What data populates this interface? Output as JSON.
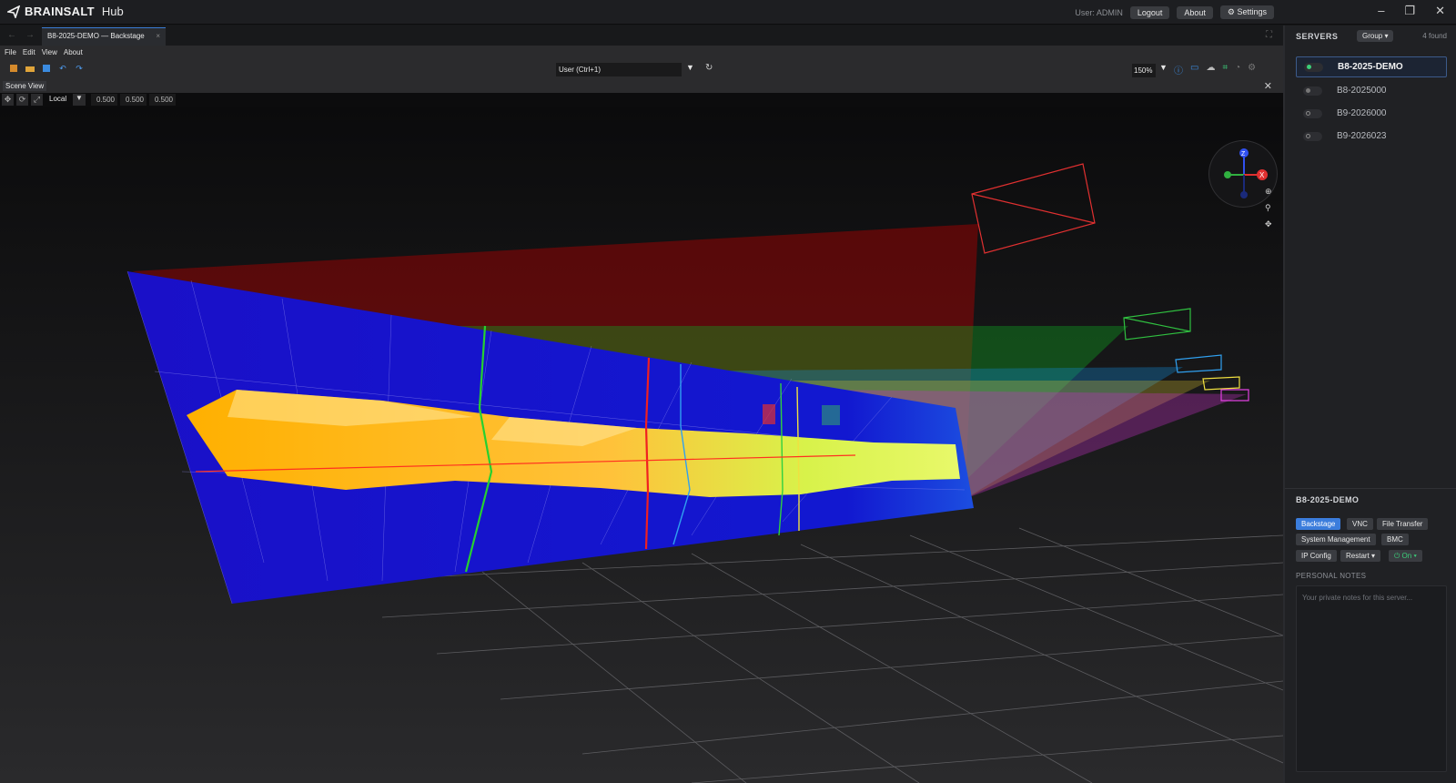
{
  "app": {
    "brand": "BRAINSALT",
    "product": "Hub"
  },
  "topbar": {
    "user": "User: ADMIN",
    "logout": "Logout",
    "about": "About",
    "settings": "⚙ Settings"
  },
  "tab": {
    "title": "B8-2025-DEMO — Backstage",
    "close": "×"
  },
  "menu": [
    "File",
    "Edit",
    "View",
    "About"
  ],
  "toolbar": {
    "camera": "User  (Ctrl+1)",
    "zoom": "150%"
  },
  "scene": {
    "panel_label": "Scene View",
    "space": "Local",
    "transform": [
      "0.500",
      "0.500",
      "0.500"
    ]
  },
  "gizmo": {
    "z": "Z",
    "x": "X"
  },
  "servers": {
    "header": "SERVERS",
    "group": "Group ▾",
    "found": "4 found",
    "items": [
      {
        "name": "B8-2025-DEMO",
        "status": "online"
      },
      {
        "name": "B8-2025000",
        "status": "idle"
      },
      {
        "name": "B9-2026000",
        "status": "offline"
      },
      {
        "name": "B9-2026023",
        "status": "offline"
      }
    ]
  },
  "details": {
    "title": "B8-2025-DEMO",
    "buttons": {
      "backstage": "Backstage",
      "vnc": "VNC",
      "file_transfer": "File Transfer",
      "system_management": "System Management",
      "bmc": "BMC",
      "ip_config": "IP Config",
      "restart": "Restart ▾",
      "power": "⏻ On ▾"
    },
    "notes_label": "PERSONAL NOTES",
    "notes_placeholder": "Your private notes for this server..."
  },
  "colors": {
    "accent": "#3b7ddc",
    "online": "#3ccf7a",
    "surface_blue": "#1a10c8",
    "fill_yellow": "#ffb300"
  }
}
